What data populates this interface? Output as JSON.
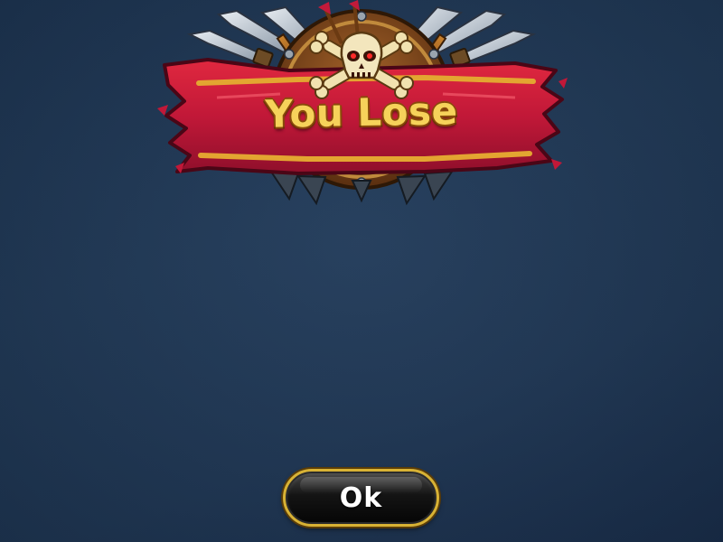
{
  "result_banner": {
    "title": "You Lose",
    "emblem": "skull-crossbones-icon",
    "decorations": [
      "sword-icon",
      "axe-icon",
      "shield-icon",
      "spear-icon"
    ]
  },
  "actions": {
    "ok_label": "Ok"
  },
  "colors": {
    "background": "#203958",
    "banner_red": "#c21a3a",
    "title_gold": "#f6d25a",
    "button_border": "#d8b234",
    "button_fill": "#111111"
  }
}
